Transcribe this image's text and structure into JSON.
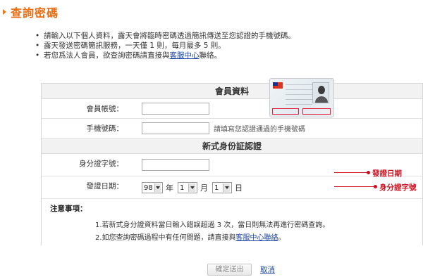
{
  "page": {
    "title": "查詢密碼"
  },
  "notes": {
    "item1": "請輸入以下個人資料，露天會將臨時密碼透過簡訊傳送至您認證的手機號碼。",
    "item2": "露天發送密碼簡訊服務，一天僅 1 則，每月最多 5 則。",
    "item3_prefix": "若您爲法人會員，欲查詢密碼請直接與",
    "item3_link": "客服中心",
    "item3_suffix": "聯絡。"
  },
  "member_section": {
    "heading": "會員資料",
    "account_label": "會員帳號：",
    "account_value": "",
    "phone_label": "手機號碼：",
    "phone_value": "",
    "phone_hint": "請填寫您認證通過的手機號碼"
  },
  "id_section": {
    "heading": "新式身份証認證",
    "id_label": "身分證字號：",
    "id_value": "",
    "date_label": "發證日期：",
    "year_value": "98",
    "year_unit": "年",
    "month_value": "1",
    "month_unit": "月",
    "day_value": "1",
    "day_unit": "日",
    "callout_date": "發證日期",
    "callout_id": "身分證字號",
    "accent_color": "#e01b3a"
  },
  "notice": {
    "title": "注意事項：",
    "item1": "1.若新式身分證資料當日輸入錯誤超過 3 次，當日則無法再進行密碼查詢。",
    "item2_prefix": "2.如您查詢密碼過程中有任何問題，請直接與",
    "item2_link": "客服中心聯絡",
    "item2_suffix": "。"
  },
  "actions": {
    "submit_label": "確定送出",
    "cancel_label": "取消"
  },
  "colors": {
    "title": "#ea6b10",
    "link": "#1a44aa"
  }
}
